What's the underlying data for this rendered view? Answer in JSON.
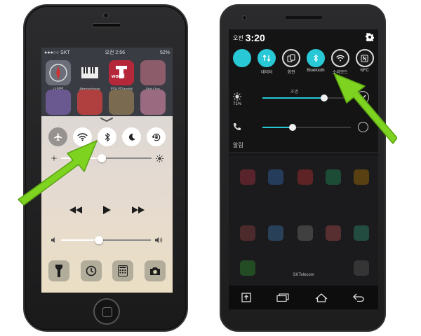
{
  "ios": {
    "status": {
      "carrier": "●●●○○ SKT",
      "time": "오전 2:56",
      "battery": "52%"
    },
    "apps": [
      {
        "label": "나침반",
        "icon": "compass-app-icon"
      },
      {
        "label": "Atmosphere",
        "icon": "piano-app-icon"
      },
      {
        "label": "모두의Tworld",
        "icon": "tworld-app-icon",
        "badge_text": "world"
      },
      {
        "label": "Not Use",
        "icon": "folder-app-icon"
      },
      {
        "label": "",
        "icon": "app-icon"
      },
      {
        "label": "",
        "icon": "app-icon"
      },
      {
        "label": "",
        "icon": "app-icon"
      },
      {
        "label": "",
        "icon": "app-icon"
      }
    ],
    "control_center": {
      "toggles": [
        {
          "name": "airplane-mode",
          "glyph": "✈",
          "on": false
        },
        {
          "name": "wifi",
          "glyph": "wifi",
          "on": true
        },
        {
          "name": "bluetooth",
          "glyph": "bluetooth",
          "on": true
        },
        {
          "name": "do-not-disturb",
          "glyph": "moon",
          "on": true
        },
        {
          "name": "rotation-lock",
          "glyph": "lock",
          "on": true
        }
      ],
      "brightness_level": 0.45,
      "volume_level": 0.42
    }
  },
  "android": {
    "status": {
      "am_pm": "오전",
      "time": "3:20"
    },
    "quick_settings": [
      {
        "label": "",
        "name": "partial-tile",
        "on": true
      },
      {
        "label": "데이터",
        "name": "data",
        "on": true
      },
      {
        "label": "회전",
        "name": "rotation",
        "on": false
      },
      {
        "label": "Bluetooth",
        "name": "bluetooth",
        "on": true
      },
      {
        "label": "소리모드",
        "name": "wifi",
        "on": false
      },
      {
        "label": "NFC",
        "name": "nfc",
        "on": false
      }
    ],
    "brightness": {
      "caption": "조명",
      "percent_label": "71%",
      "level": 0.71
    },
    "volume": {
      "level": 0.35
    },
    "notifications_header": "알림",
    "carrier": "SKTelecom",
    "nav": [
      "screenshot",
      "recent-apps",
      "home",
      "back"
    ]
  },
  "colors": {
    "arrow": "#7ed321",
    "android_accent": "#29c8d6"
  }
}
